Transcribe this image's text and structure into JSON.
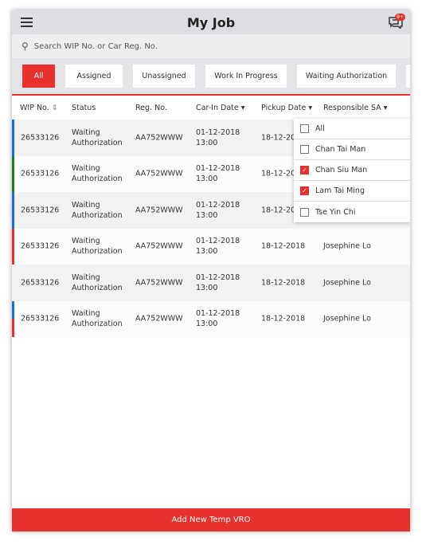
{
  "header": {
    "title": "My Job",
    "menu_icon": "hamburger-icon",
    "chat_icon": "chat-icon",
    "badge": "9+"
  },
  "search": {
    "placeholder": "Search WIP No. or Car Reg. No."
  },
  "filters": [
    "All",
    "Assigned",
    "Unassigned",
    "Work In Progress",
    "Waiting Authorization"
  ],
  "columns": {
    "wip": "WIP No.",
    "status": "Status",
    "reg": "Reg. No.",
    "carin": "Car-In Date",
    "pickup": "Pickup Date",
    "sa": "Responsible SA"
  },
  "rows": [
    {
      "wip": "26533126",
      "status1": "Waiting",
      "status2": "Authorization",
      "reg": "AA752WWW",
      "carin1": "01-12-2018",
      "carin2": "13:00",
      "pickup": "18-12-2018",
      "sa": "",
      "stripe": [
        "#1a6fd6"
      ]
    },
    {
      "wip": "26533126",
      "status1": "Waiting",
      "status2": "Authorization",
      "reg": "AA752WWW",
      "carin1": "01-12-2018",
      "carin2": "13:00",
      "pickup": "18-12-2018",
      "sa": "",
      "stripe": [
        "#1e7d2a"
      ]
    },
    {
      "wip": "26533126",
      "status1": "Waiting",
      "status2": "Authorization",
      "reg": "AA752WWW",
      "carin1": "01-12-2018",
      "carin2": "13:00",
      "pickup": "18-12-2018",
      "sa": "",
      "stripe": [
        "#1a6fd6"
      ]
    },
    {
      "wip": "26533126",
      "status1": "Waiting",
      "status2": "Authorization",
      "reg": "AA752WWW",
      "carin1": "01-12-2018",
      "carin2": "13:00",
      "pickup": "18-12-2018",
      "sa": "Josephine Lo",
      "stripe": [
        "#e8312f"
      ]
    },
    {
      "wip": "26533126",
      "status1": "Waiting",
      "status2": "Authorization",
      "reg": "AA752WWW",
      "carin1": "01-12-2018",
      "carin2": "13:00",
      "pickup": "18-12-2018",
      "sa": "Josephine Lo",
      "stripe": []
    },
    {
      "wip": "26533126",
      "status1": "Waiting",
      "status2": "Authorization",
      "reg": "AA752WWW",
      "carin1": "01-12-2018",
      "carin2": "13:00",
      "pickup": "18-12-2018",
      "sa": "Josephine Lo",
      "stripe": [
        "#1a6fd6",
        "#e8312f"
      ]
    }
  ],
  "dropdown": [
    {
      "label": "All",
      "checked": false
    },
    {
      "label": "Chan Tai Man",
      "checked": false
    },
    {
      "label": "Chan Siu Man",
      "checked": true
    },
    {
      "label": "Lam Tai Ming",
      "checked": true
    },
    {
      "label": "Tse Yin Chi",
      "checked": false
    }
  ],
  "bottom_button": "Add New Temp VRO",
  "accent": "#e8312f"
}
